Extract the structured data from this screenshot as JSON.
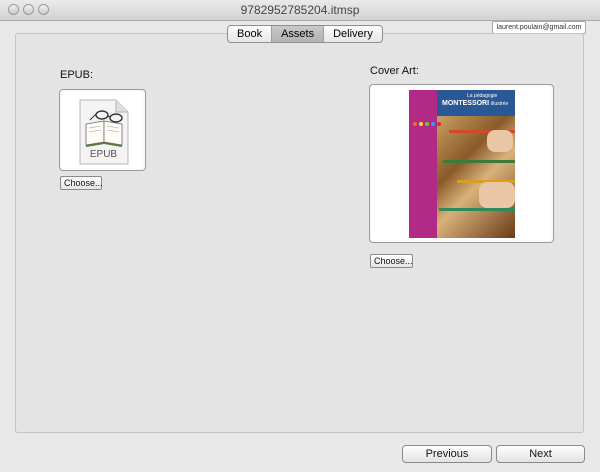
{
  "window": {
    "title": "9782952785204.itmsp"
  },
  "account": {
    "email": "laurent.poulain@gmail.com"
  },
  "tabs": [
    {
      "label": "Book",
      "active": false
    },
    {
      "label": "Assets",
      "active": true
    },
    {
      "label": "Delivery",
      "active": false
    }
  ],
  "epub": {
    "label": "EPUB:",
    "file_icon_label": "EPUB",
    "choose_label": "Choose..."
  },
  "cover_art": {
    "label": "Cover Art:",
    "choose_label": "Choose...",
    "image": {
      "title_small": "La pédagogie",
      "title_main": "MONTESSORI",
      "title_suffix": "illustrée"
    }
  },
  "footer": {
    "previous_label": "Previous",
    "next_label": "Next"
  }
}
